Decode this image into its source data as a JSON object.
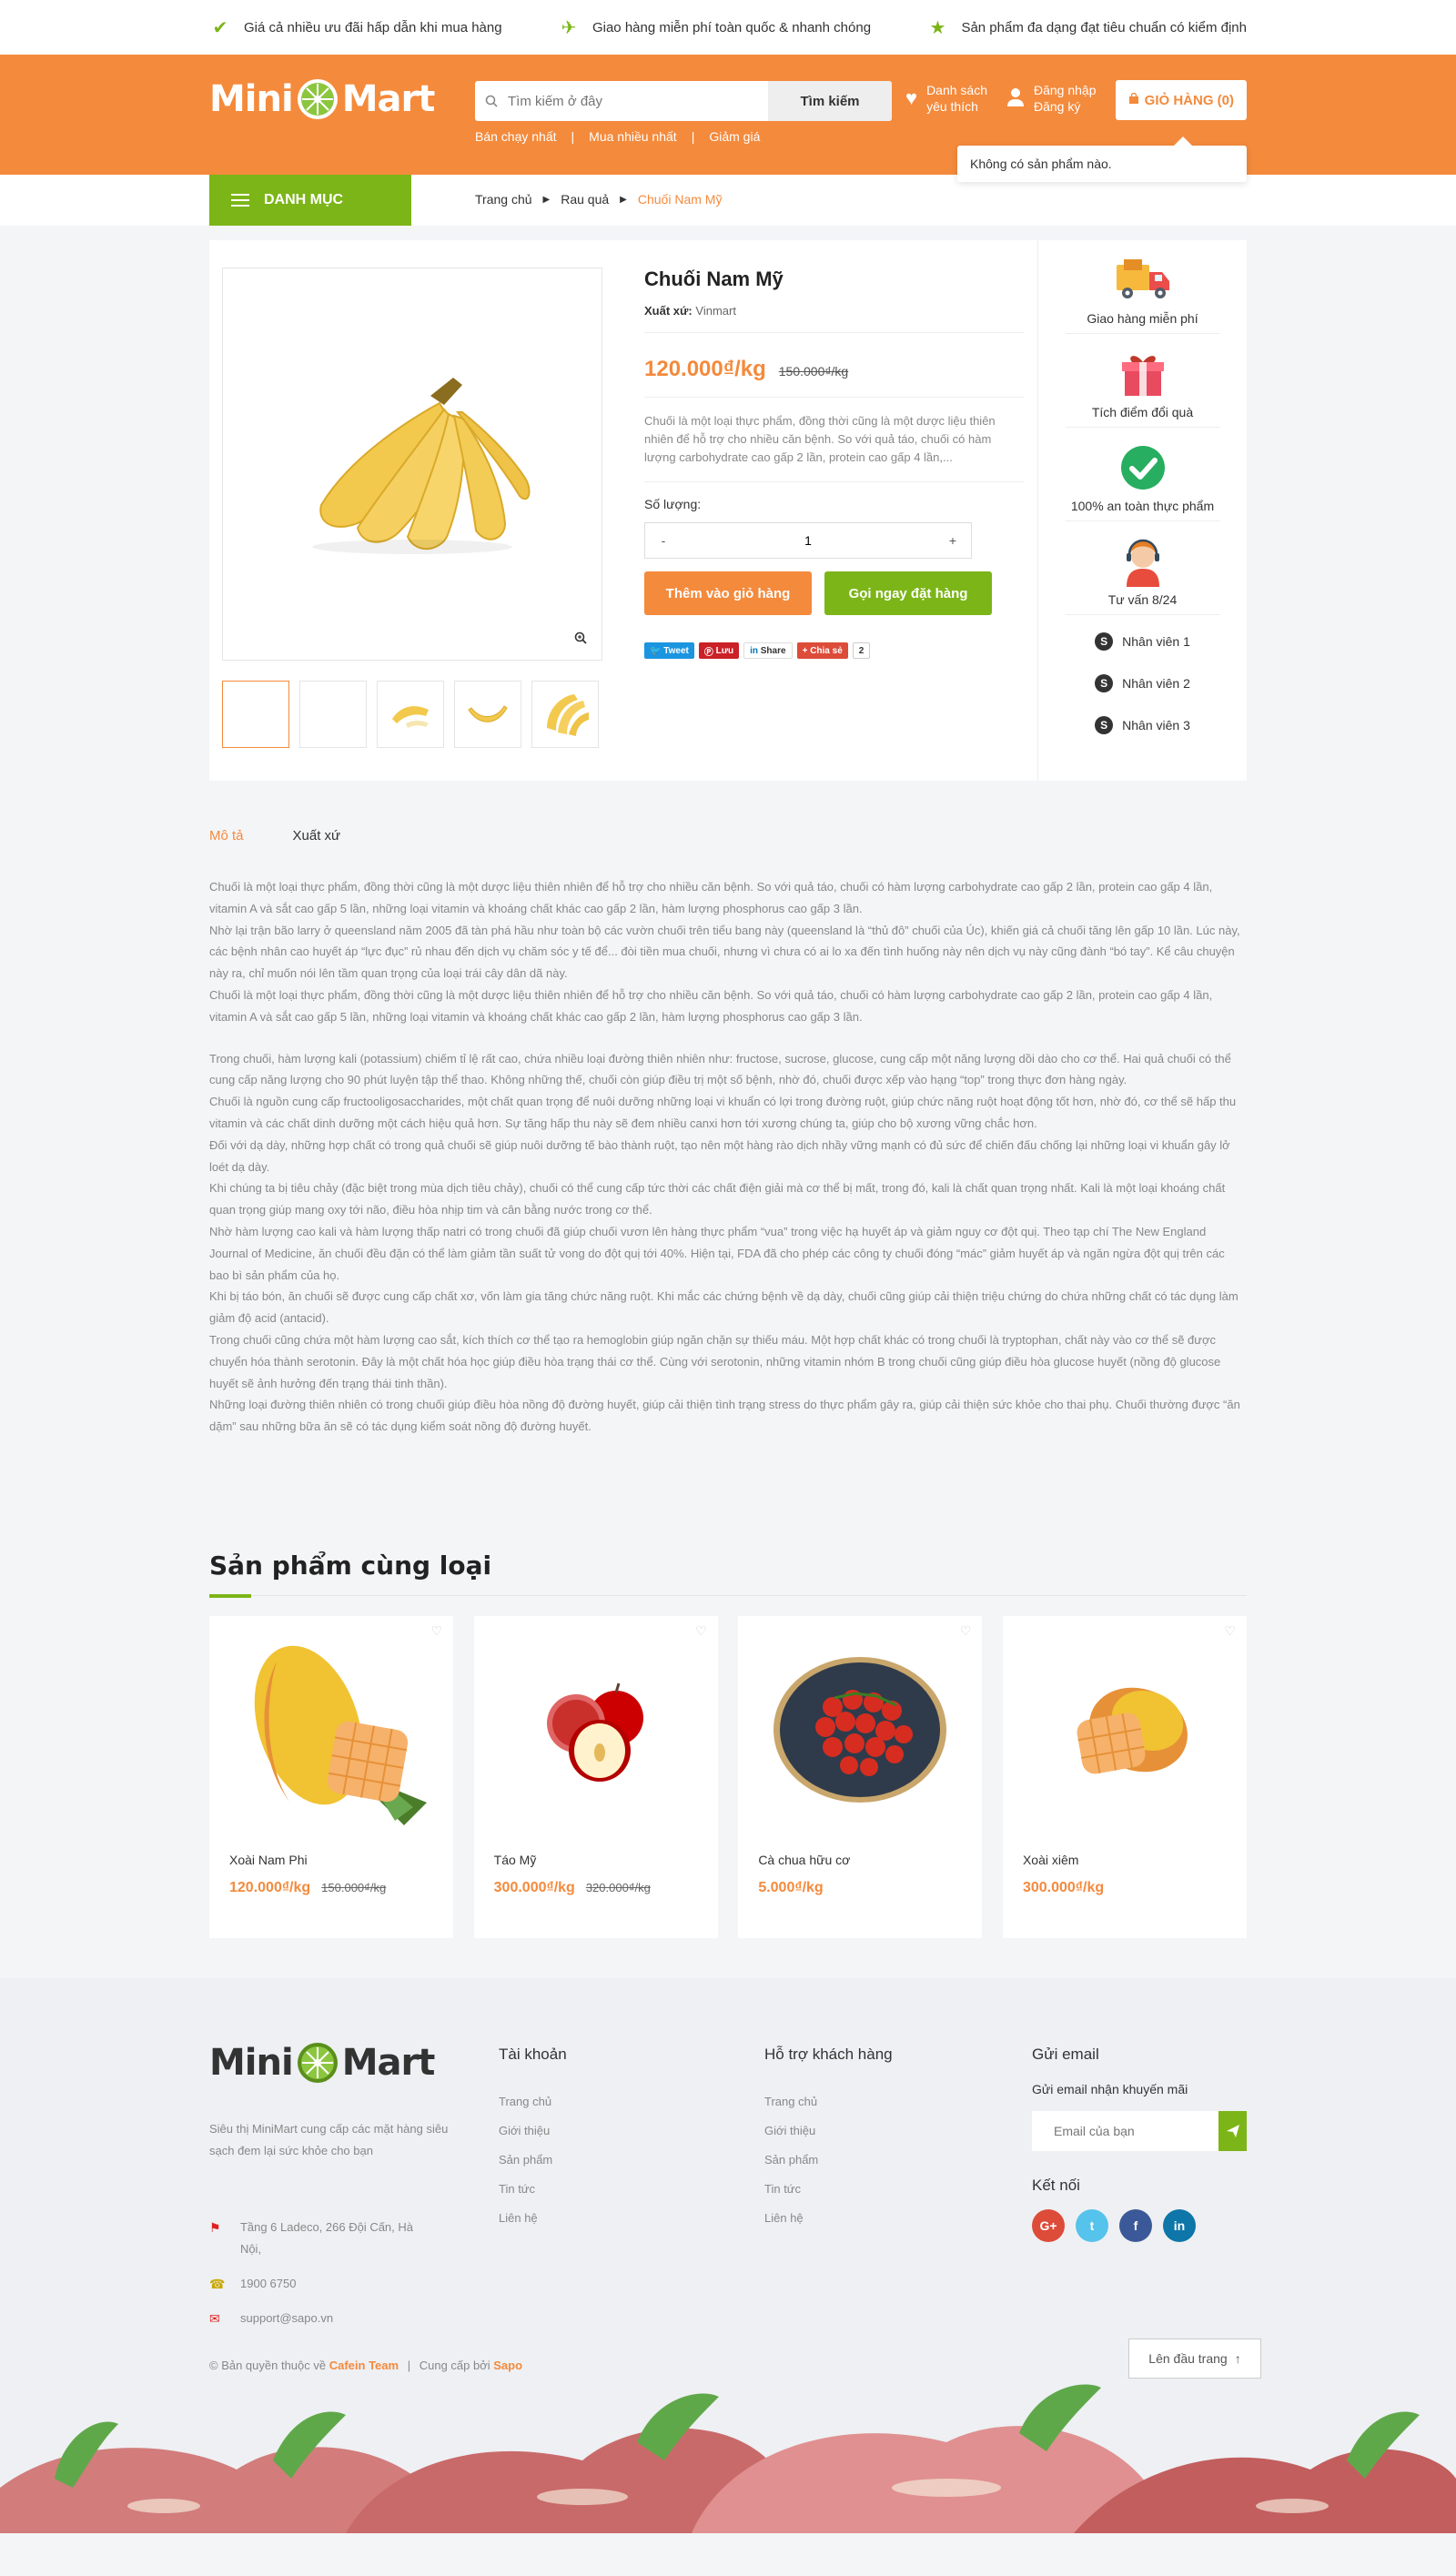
{
  "topbar": {
    "items": [
      "Giá cả nhiều ưu đãi hấp dẫn khi mua hàng",
      "Giao hàng miễn phí toàn quốc & nhanh chóng",
      "Sản phẩm đa dạng đạt tiêu chuẩn có kiểm định"
    ]
  },
  "header": {
    "logo_left": "Mini",
    "logo_right": "Mart",
    "search_placeholder": "Tìm kiếm ở đây",
    "search_button": "Tìm kiếm",
    "quick_links": [
      "Bán chạy nhất",
      "Mua nhiều nhất",
      "Giảm giá"
    ],
    "wishlist_line1": "Danh sách",
    "wishlist_line2": "yêu thích",
    "login": "Đăng nhập",
    "register": "Đăng ký",
    "cart": "GIỎ HÀNG (0)",
    "cart_popup": "Không có sản phẩm nào."
  },
  "nav": {
    "category": "DANH MỤC",
    "breadcrumb": [
      "Trang chủ",
      "Rau quả",
      "Chuối Nam Mỹ"
    ]
  },
  "product": {
    "name": "Chuối Nam Mỹ",
    "origin_label": "Xuất xứ:",
    "origin_value": "Vinmart",
    "price": "120.000₫/kg",
    "old_price": "150.000₫/kg",
    "short_desc": "Chuối là một loại thực phẩm, đồng thời cũng là một dược liệu thiên nhiên để hỗ trợ cho nhiều căn bệnh. So với quả táo, chuối có hàm lượng carbohydrate cao gấp 2 lần, protein cao gấp 4 lần,...",
    "qty_label": "Số lượng:",
    "qty_minus": "-",
    "qty_value": "1",
    "qty_plus": "+",
    "add_cart": "Thêm vào giỏ hàng",
    "order_now": "Gọi ngay đặt hàng",
    "share": {
      "tweet": "Tweet",
      "pin": "Lưu",
      "linkedin": "Share",
      "google": "Chia sẻ",
      "count": "2"
    }
  },
  "side": {
    "features": [
      "Giao hàng miễn phí",
      "Tích điểm đổi quà",
      "100% an toàn thực phẩm",
      "Tư vấn 8/24"
    ],
    "staff": [
      "Nhân viên 1",
      "Nhân viên 2",
      "Nhân viên 3"
    ]
  },
  "tabs": [
    "Mô tả",
    "Xuất xứ"
  ],
  "description": [
    "Chuối là một loại thực phẩm, đồng thời cũng là một dược liệu thiên nhiên để hỗ trợ cho nhiều căn bệnh. So với quả táo, chuối có hàm lượng carbohydrate cao gấp 2 lần, protein cao gấp 4 lần, vitamin A và sắt cao gấp 5 lần, những loại vitamin và khoáng chất khác cao gấp 2 lần, hàm lượng phosphorus cao gấp 3 lần.",
    "Nhờ lại trận bão larry ở queensland năm 2005 đã tàn phá hầu như toàn bộ các vườn chuối trên tiểu bang này (queensland là “thủ đô” chuối của Úc), khiến giá cả chuối tăng lên gấp 10 lần. Lúc này, các bệnh nhân cao huyết áp “lực đục” rủ nhau đến dịch vụ chăm sóc y tế để... đòi tiền mua chuối, nhưng vì chưa có ai lo xa đến tình huống này nên dịch vụ này cũng đành “bó tay”. Kể câu chuyện này ra, chỉ muốn nói lên tầm quan trọng của loại trái cây dân dã này.",
    "Chuối là một loại thực phẩm, đồng thời cũng là một dược liệu thiên nhiên để hỗ trợ cho nhiều căn bệnh. So với quả táo, chuối có hàm lượng carbohydrate cao gấp 2 lần, protein cao gấp 4 lần, vitamin A và sắt cao gấp 5 lần, những loại vitamin và khoáng chất khác cao gấp 2 lần, hàm lượng phosphorus cao gấp 3 lần.",
    "Trong chuối, hàm lượng kali (potassium) chiếm tỉ lệ rất cao, chứa nhiều loại đường thiên nhiên như: fructose, sucrose, glucose, cung cấp một năng lượng dồi dào cho cơ thể. Hai quả chuối có thể cung cấp năng lượng cho 90 phút luyện tập thể thao. Không những thế, chuối còn giúp điều trị một số bệnh, nhờ đó, chuối được xếp vào hạng “top” trong thực đơn hàng ngày.",
    "Chuối là nguồn cung cấp fructooligosaccharides, một chất quan trọng để nuôi dưỡng những loại vi khuẩn có lợi trong đường ruột, giúp chức năng ruột hoạt động tốt hơn, nhờ đó, cơ thể sẽ hấp thu vitamin và các chất dinh dưỡng một cách hiệu quả hơn. Sự tăng hấp thu này sẽ đem nhiều canxi hơn tới xương chúng ta, giúp cho bộ xương vững chắc hơn.",
    "Đối với dạ dày, những hợp chất có trong quả chuối sẽ giúp nuôi dưỡng tế bào thành ruột, tạo nên một hàng rào dịch nhầy vững mạnh có đủ sức để chiến đấu chống lại những loại vi khuẩn gây lở loét dạ dày.",
    "Khi chúng ta bị tiêu chảy (đặc biệt trong mùa dịch tiêu chảy), chuối có thể cung cấp tức thời các chất điện giải mà cơ thể bị mất, trong đó, kali là chất quan trọng nhất. Kali là một loại khoáng chất quan trọng giúp mang oxy tới não, điều hòa nhịp tim và cân bằng nước trong cơ thể.",
    "Nhờ hàm lượng cao kali và hàm lượng thấp natri có trong chuối đã giúp chuối vươn lên hàng thực phẩm “vua” trong việc hạ huyết áp và giảm nguy cơ đột quị. Theo tạp chí The New England Journal of Medicine, ăn chuối đều đặn có thể làm giảm tần suất tử vong do đột quị tới 40%. Hiện tại, FDA đã cho phép các công ty chuối đóng “mác” giảm huyết áp và ngăn ngừa đột quị trên các bao bì sản phẩm của họ.",
    "Khi bị táo bón, ăn chuối sẽ được cung cấp chất xơ, vốn làm gia tăng chức năng ruột. Khi mắc các chứng bệnh về dạ dày, chuối cũng giúp cải thiện triệu chứng do chứa những chất có tác dụng làm giảm độ acid (antacid).",
    "Trong chuối cũng chứa một hàm lượng cao sắt, kích thích cơ thể tạo ra hemoglobin giúp ngăn chặn sự thiếu máu. Một hợp chất khác có trong chuối là tryptophan, chất này vào cơ thể sẽ được chuyển hóa thành serotonin. Đây là một chất hóa học giúp điều hòa trạng thái cơ thể. Cùng với serotonin, những vitamin nhóm B trong chuối cũng giúp điều hòa glucose huyết (nồng độ glucose huyết sẽ ảnh hưởng đến trạng thái tinh thần).",
    "Những loại đường thiên nhiên có trong chuối giúp điều hòa nồng độ đường huyết, giúp cải thiện tình trạng stress do thực phẩm gây ra, giúp cải thiện sức khỏe cho thai phụ. Chuối thường được “ăn dặm” sau những bữa ăn sẽ có tác dụng kiểm soát nồng độ đường huyết."
  ],
  "related": {
    "title": "Sản phẩm cùng loại",
    "items": [
      {
        "name": "Xoài Nam Phi",
        "price": "120.000₫/kg",
        "old": "150.000₫/kg"
      },
      {
        "name": "Táo Mỹ",
        "price": "300.000₫/kg",
        "old": "320.000₫/kg"
      },
      {
        "name": "Cà chua hữu cơ",
        "price": "5.000₫/kg",
        "old": ""
      },
      {
        "name": "Xoài xiêm",
        "price": "300.000₫/kg",
        "old": ""
      }
    ]
  },
  "footer": {
    "about": "Siêu thị MiniMart cung cấp các mặt hàng siêu sạch đem lại sức khỏe cho bạn",
    "address": "Tầng 6 Ladeco, 266 Đội Cấn, Hà Nội,",
    "phone": "1900 6750",
    "email": "support@sapo.vn",
    "account_title": "Tài khoản",
    "account_links": [
      "Trang chủ",
      "Giới thiệu",
      "Sản phẩm",
      "Tin tức",
      "Liên hệ"
    ],
    "support_title": "Hỗ trợ khách hàng",
    "support_links": [
      "Trang chủ",
      "Giới thiệu",
      "Sản phẩm",
      "Tin tức",
      "Liên hệ"
    ],
    "email_title": "Gửi email",
    "email_label": "Gửi email nhận khuyến mãi",
    "email_placeholder": "Email của bạn",
    "connect_title": "Kết nối",
    "copy_prefix": "© Bản quyền thuộc về",
    "copy_team": "Cafein Team",
    "copy_sep": "|",
    "copy_by": "Cung cấp bởi",
    "copy_sapo": "Sapo",
    "back_top": "Lên đầu trang"
  },
  "colors": {
    "accent": "#f48a3c",
    "green": "#7cb518"
  }
}
